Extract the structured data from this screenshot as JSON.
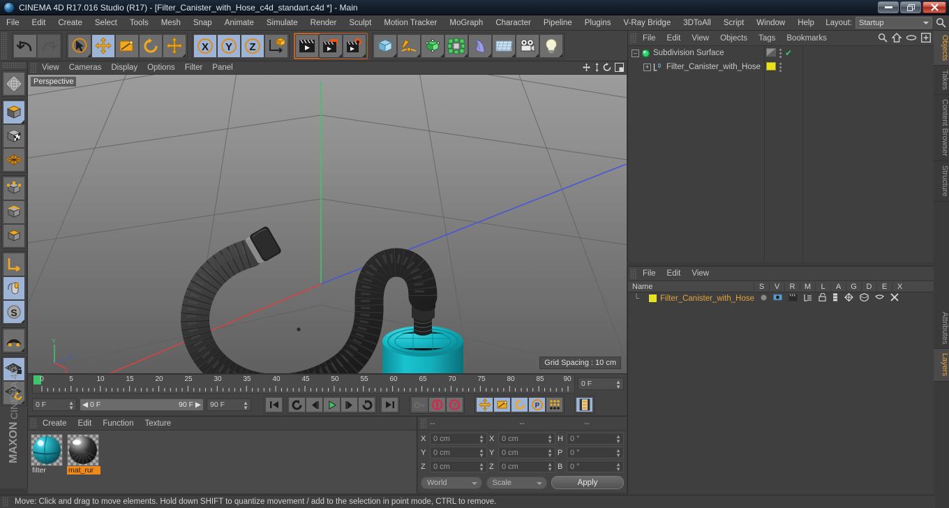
{
  "window": {
    "title": "CINEMA 4D R17.016 Studio (R17) - [Filter_Canister_with_Hose_c4d_standart.c4d *] - Main",
    "minimize": "–",
    "restore": "❐",
    "close": "✕"
  },
  "menubar": {
    "items": [
      "File",
      "Edit",
      "Create",
      "Select",
      "Tools",
      "Mesh",
      "Snap",
      "Animate",
      "Simulate",
      "Render",
      "Sculpt",
      "Motion Tracker",
      "MoGraph",
      "Character",
      "Pipeline",
      "Plugins",
      "V-Ray Bridge",
      "3DToAll",
      "Script",
      "Window",
      "Help"
    ],
    "layout_label": "Layout:",
    "layout_value": "Startup",
    "search_icon": "search-icon"
  },
  "toolbar": {
    "groups": [
      {
        "name": "history",
        "buttons": [
          {
            "name": "undo-button",
            "icon": "undo-arrow-icon",
            "state": "normal"
          },
          {
            "name": "redo-button",
            "icon": "redo-arrow-icon",
            "state": "disabled"
          }
        ]
      },
      {
        "name": "transform-tools",
        "buttons": [
          {
            "name": "live-selection-tool",
            "icon": "cursor-circle-icon",
            "state": "normal"
          },
          {
            "name": "move-tool",
            "icon": "move-arrows-icon",
            "state": "selected"
          },
          {
            "name": "scale-tool",
            "icon": "scale-box-icon",
            "state": "normal"
          },
          {
            "name": "rotate-tool",
            "icon": "rotate-ring-icon",
            "state": "normal"
          },
          {
            "name": "move-dynamic-tool",
            "icon": "move-arrows-icon",
            "state": "normal"
          }
        ]
      },
      {
        "name": "axis-locks",
        "buttons": [
          {
            "name": "lock-x-axis",
            "icon": "x-axis-icon",
            "state": "selected"
          },
          {
            "name": "lock-y-axis",
            "icon": "y-axis-icon",
            "state": "selected"
          },
          {
            "name": "lock-z-axis",
            "icon": "z-axis-icon",
            "state": "selected"
          },
          {
            "name": "world-object-axis",
            "icon": "world-axis-cube-icon",
            "state": "normal"
          }
        ]
      },
      {
        "name": "render-group",
        "buttons": [
          {
            "name": "render-view-button",
            "icon": "clapperboard-icon",
            "state": "active"
          },
          {
            "name": "render-to-picture-viewer-button",
            "icon": "clapperboard-screen-icon",
            "state": "normal"
          },
          {
            "name": "edit-render-settings-button",
            "icon": "clapperboard-gear-icon",
            "state": "normal"
          }
        ]
      },
      {
        "name": "create-group",
        "buttons": [
          {
            "name": "add-cube-button",
            "icon": "cube-icon",
            "state": "normal"
          },
          {
            "name": "add-spline-button",
            "icon": "pen-spline-icon",
            "state": "normal"
          },
          {
            "name": "add-nurbs-button",
            "icon": "green-cube-icon",
            "state": "normal"
          },
          {
            "name": "add-mograph-button",
            "icon": "cloner-icon",
            "state": "normal"
          },
          {
            "name": "add-deformer-button",
            "icon": "bend-deformer-icon",
            "state": "normal"
          },
          {
            "name": "add-environment-button",
            "icon": "floor-grid-icon",
            "state": "normal"
          },
          {
            "name": "add-camera-button",
            "icon": "camera-icon",
            "state": "normal"
          },
          {
            "name": "add-light-button",
            "icon": "lightbulb-icon",
            "state": "normal"
          }
        ]
      }
    ]
  },
  "left_toolbar": {
    "groups": [
      {
        "name": "global-local",
        "buttons": [
          {
            "name": "make-editable-button",
            "icon": "globe-wire-icon",
            "state": "normal"
          }
        ]
      },
      {
        "name": "modes",
        "buttons": [
          {
            "name": "model-mode-button",
            "icon": "model-cube-icon",
            "state": "selected"
          },
          {
            "name": "texture-mode-button",
            "icon": "texture-cube-icon",
            "state": "normal"
          },
          {
            "name": "workplane-mode-button",
            "icon": "workplane-icon",
            "state": "normal"
          }
        ]
      },
      {
        "name": "components",
        "buttons": [
          {
            "name": "points-mode-button",
            "icon": "points-cube-icon",
            "state": "normal"
          },
          {
            "name": "edges-mode-button",
            "icon": "edges-cube-icon",
            "state": "normal"
          },
          {
            "name": "polygons-mode-button",
            "icon": "polygons-cube-icon",
            "state": "normal"
          }
        ]
      },
      {
        "name": "axis-tools",
        "buttons": [
          {
            "name": "enable-axis-button",
            "icon": "axis-L-icon",
            "state": "normal"
          },
          {
            "name": "viewport-solo-button",
            "icon": "mouse-icon",
            "state": "selected"
          },
          {
            "name": "soft-selection-button",
            "icon": "s-circle-icon",
            "state": "selected"
          }
        ]
      },
      {
        "name": "snap-group",
        "buttons": [
          {
            "name": "enable-snapping-button",
            "icon": "magnet-icon",
            "state": "normal"
          }
        ]
      },
      {
        "name": "workplane-group",
        "buttons": [
          {
            "name": "lock-workplane-button",
            "icon": "grid-lock-icon",
            "state": "selected"
          },
          {
            "name": "planar-workplane-button",
            "icon": "grid-rotate-icon",
            "state": "normal"
          }
        ]
      }
    ],
    "brand_1": "MAXON",
    "brand_2": "CINEMA 4D"
  },
  "viewport": {
    "menus": [
      "View",
      "Cameras",
      "Display",
      "Options",
      "Filter",
      "Panel"
    ],
    "label": "Perspective",
    "grid_spacing": "Grid Spacing : 10 cm",
    "head_icons": [
      "pan-camera-icon",
      "dolly-camera-icon",
      "rotate-camera-icon",
      "maximize-viewport-icon"
    ],
    "axis_gizmo": {
      "y": "Y",
      "z": "Z",
      "x": "X"
    },
    "scene_description": "Perspective view of a teal filter canister connected to a long black corrugated breathing hose lying on the ground grid"
  },
  "timeline": {
    "ticks": [
      "0",
      "5",
      "10",
      "15",
      "20",
      "25",
      "30",
      "35",
      "40",
      "45",
      "50",
      "55",
      "60",
      "65",
      "70",
      "75",
      "80",
      "85",
      "90"
    ],
    "current_frame_field": "0 F",
    "current_frame_left": "0 F",
    "range_start": "0 F",
    "range_end": "90 F",
    "range_max_field": "90 F",
    "buttons": [
      {
        "name": "go-to-start-button",
        "icon": "skip-start-icon",
        "state": "normal"
      },
      {
        "name": "previous-key-button",
        "icon": "prev-key-icon",
        "state": "normal"
      },
      {
        "name": "step-back-button",
        "icon": "step-back-icon",
        "state": "normal"
      },
      {
        "name": "play-button",
        "icon": "play-icon",
        "state": "normal"
      },
      {
        "name": "step-forward-button",
        "icon": "step-forward-icon",
        "state": "normal"
      },
      {
        "name": "next-key-button",
        "icon": "next-key-icon",
        "state": "normal"
      },
      {
        "name": "go-to-end-button",
        "icon": "skip-end-icon",
        "state": "normal"
      },
      {
        "name": "record-active-objects-button",
        "icon": "key-icon",
        "state": "disabled"
      },
      {
        "name": "autokeying-button",
        "icon": "autokey-icon",
        "state": "normal"
      },
      {
        "name": "keyframe-selection-button",
        "icon": "question-key-icon",
        "state": "normal"
      },
      {
        "name": "position-key-button",
        "icon": "move-arrows-icon",
        "state": "selected"
      },
      {
        "name": "scale-key-button",
        "icon": "scale-box-icon",
        "state": "selected"
      },
      {
        "name": "rotation-key-button",
        "icon": "rotate-ring-icon",
        "state": "selected"
      },
      {
        "name": "parameter-key-button",
        "icon": "p-circle-icon",
        "state": "selected"
      },
      {
        "name": "point-level-animation-button",
        "icon": "pla-dots-icon",
        "state": "normal"
      },
      {
        "name": "timeline-toggle-button",
        "icon": "film-strip-icon",
        "state": "selected"
      }
    ]
  },
  "material_manager": {
    "menus": [
      "Create",
      "Edit",
      "Function",
      "Texture"
    ],
    "materials": [
      {
        "name": "filter",
        "selected": false,
        "color": "#1b9aa8"
      },
      {
        "name": "mat_rur",
        "selected": true,
        "color": "#2a2a2a"
      }
    ]
  },
  "coordinates": {
    "header": [
      "--",
      "--",
      "--"
    ],
    "rows": [
      {
        "axis_pos": "X",
        "pos_value": "0 cm",
        "axis_size": "X",
        "size_value": "0 cm",
        "axis_rot": "H",
        "rot_value": "0 °"
      },
      {
        "axis_pos": "Y",
        "pos_value": "0 cm",
        "axis_size": "Y",
        "size_value": "0 cm",
        "axis_rot": "P",
        "rot_value": "0 °"
      },
      {
        "axis_pos": "Z",
        "pos_value": "0 cm",
        "axis_size": "Z",
        "size_value": "0 cm",
        "axis_rot": "B",
        "rot_value": "0 °"
      }
    ],
    "coord_system": "World",
    "size_mode": "Scale",
    "apply_label": "Apply"
  },
  "object_manager": {
    "menus": [
      "File",
      "Edit",
      "View",
      "Objects",
      "Tags",
      "Bookmarks"
    ],
    "head_icons": [
      "search-icon",
      "home-icon",
      "ellipse-icon",
      "new-window-icon"
    ],
    "rows": [
      {
        "name": "Subdivision Surface",
        "icon": "subdivision-surface-icon",
        "indent": 0,
        "tag_type": "display-tag",
        "visible_check": "✔"
      },
      {
        "name": "Filter_Canister_with_Hose",
        "icon": "polygon-object-icon",
        "indent": 1,
        "tag_type": "material-tag",
        "tag_color": "#e8e224"
      }
    ]
  },
  "layers_manager": {
    "menus": [
      "File",
      "Edit",
      "View"
    ],
    "columns": [
      "Name",
      "S",
      "V",
      "R",
      "M",
      "L",
      "A",
      "G",
      "D",
      "E",
      "X"
    ],
    "rows": [
      {
        "name": "Filter_Canister_with_Hose",
        "color": "#e8e224"
      }
    ]
  },
  "right_tabs_top": [
    {
      "label": "Objects",
      "active": true
    },
    {
      "label": "Takes",
      "active": false
    },
    {
      "label": "Content Browser",
      "active": false
    },
    {
      "label": "Structure",
      "active": false
    }
  ],
  "right_tabs_bottom": [
    {
      "label": "Attributes",
      "active": false
    },
    {
      "label": "Layers",
      "active": true
    }
  ],
  "statusbar": {
    "text": "Move: Click and drag to move elements. Hold down SHIFT to quantize movement / add to the selection in point mode, CTRL to remove."
  }
}
